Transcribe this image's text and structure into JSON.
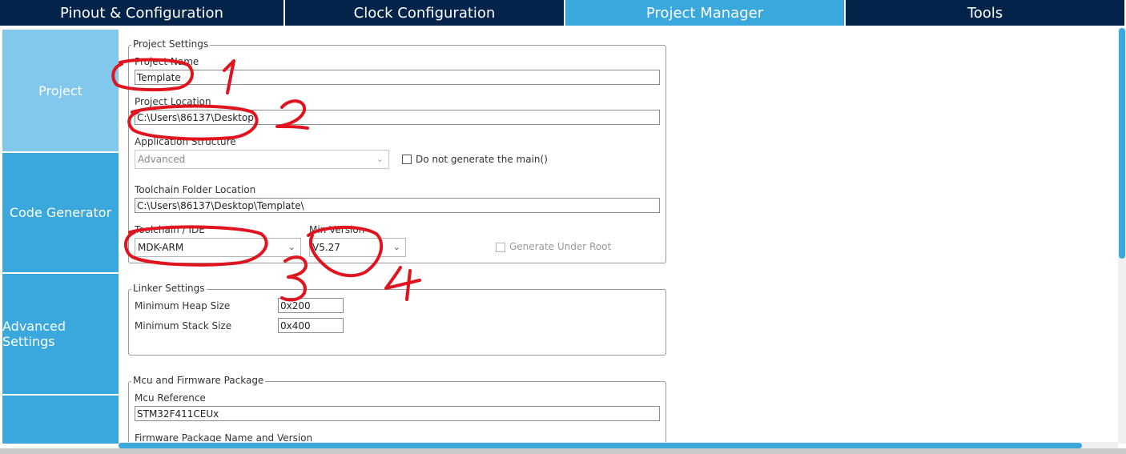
{
  "tabs": [
    {
      "label": "Pinout & Configuration"
    },
    {
      "label": "Clock Configuration"
    },
    {
      "label": "Project Manager"
    },
    {
      "label": "Tools"
    }
  ],
  "sidebar": {
    "items": [
      {
        "label": "Project"
      },
      {
        "label": "Code Generator"
      },
      {
        "label": "Advanced Settings"
      }
    ]
  },
  "project_settings": {
    "legend": "Project Settings",
    "project_name_label": "Project Name",
    "project_name_value": "Template",
    "project_location_label": "Project Location",
    "project_location_value": "C:\\Users\\86137\\Desktop",
    "app_structure_label": "Application Structure",
    "app_structure_value": "Advanced",
    "no_main_label": "Do not generate the main()",
    "toolchain_folder_label": "Toolchain Folder Location",
    "toolchain_folder_value": "C:\\Users\\86137\\Desktop\\Template\\",
    "toolchain_ide_label": "Toolchain / IDE",
    "toolchain_ide_value": "MDK-ARM",
    "min_version_label": "Min Version",
    "min_version_value": "V5.27",
    "generate_under_root_label": "Generate Under Root"
  },
  "linker_settings": {
    "legend": "Linker Settings",
    "heap_label": "Minimum Heap Size",
    "heap_value": "0x200",
    "stack_label": "Minimum Stack Size",
    "stack_value": "0x400"
  },
  "mcu_package": {
    "legend": "Mcu and Firmware Package",
    "mcu_ref_label": "Mcu Reference",
    "mcu_ref_value": "STM32F411CEUx",
    "firmware_label": "Firmware Package Name and Version"
  },
  "annotations": {
    "color": "#e0141e",
    "numbers": [
      "1",
      "2",
      "3",
      "4"
    ]
  },
  "colors": {
    "tab_dark": "#03234b",
    "tab_active": "#3aa8dd",
    "sidebar_active": "#82c8ec",
    "sidebar_normal": "#3aa8dd"
  }
}
